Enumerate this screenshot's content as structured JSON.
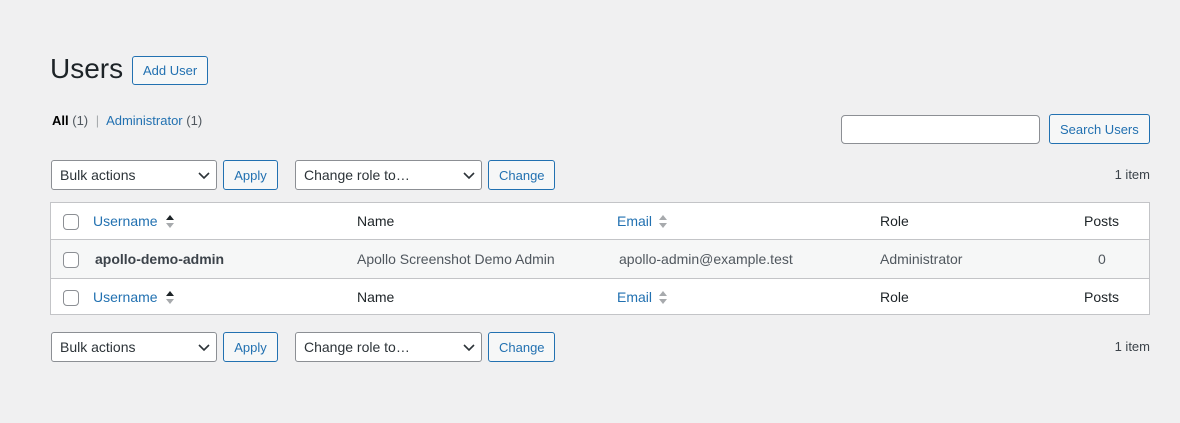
{
  "page": {
    "title": "Users",
    "add_user_label": "Add User"
  },
  "filters": {
    "all_label": "All",
    "all_count": "(1)",
    "separator": "|",
    "admin_label": "Administrator",
    "admin_count": "(1)"
  },
  "search": {
    "value": "",
    "placeholder": "",
    "button_label": "Search Users"
  },
  "tablenav": {
    "bulk_actions_selected": "Bulk actions",
    "apply_label": "Apply",
    "change_role_selected": "Change role to…",
    "change_label": "Change",
    "item_count": "1 item"
  },
  "table": {
    "columns": {
      "username": "Username",
      "name": "Name",
      "email": "Email",
      "role": "Role",
      "posts": "Posts"
    },
    "rows": [
      {
        "username": "apollo-demo-admin",
        "name": "Apollo Screenshot Demo Admin",
        "email": "apollo-admin@example.test",
        "role": "Administrator",
        "posts": "0"
      }
    ]
  },
  "colors": {
    "accent": "#2271b1",
    "background": "#f0f0f1",
    "border": "#c3c4c7"
  },
  "icons": {
    "sort_asc": "sort-ascending-icon",
    "sort_both": "sort-icon",
    "select_arrow": "chevron-down-icon"
  }
}
